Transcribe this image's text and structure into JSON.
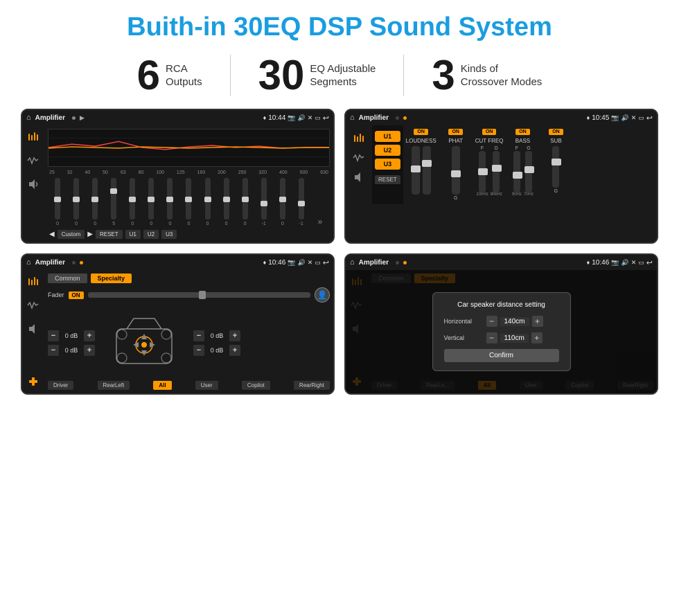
{
  "page": {
    "title": "Buith-in 30EQ DSP Sound System",
    "stats": [
      {
        "number": "6",
        "text_line1": "RCA",
        "text_line2": "Outputs"
      },
      {
        "number": "30",
        "text_line1": "EQ Adjustable",
        "text_line2": "Segments"
      },
      {
        "number": "3",
        "text_line1": "Kinds of",
        "text_line2": "Crossover Modes"
      }
    ]
  },
  "screen1": {
    "status": {
      "title": "Amplifier",
      "time": "10:44"
    },
    "eq_frequencies": [
      "25",
      "32",
      "40",
      "50",
      "63",
      "80",
      "100",
      "125",
      "160",
      "200",
      "250",
      "320",
      "400",
      "500",
      "630"
    ],
    "eq_values": [
      "0",
      "0",
      "0",
      "5",
      "0",
      "0",
      "0",
      "0",
      "0",
      "0",
      "0",
      "-1",
      "0",
      "-1"
    ],
    "buttons": [
      "Custom",
      "RESET",
      "U1",
      "U2",
      "U3"
    ]
  },
  "screen2": {
    "status": {
      "title": "Amplifier",
      "time": "10:45"
    },
    "presets": [
      "U1",
      "U2",
      "U3"
    ],
    "channels": [
      {
        "label": "LOUDNESS",
        "on": true
      },
      {
        "label": "PHAT",
        "on": true
      },
      {
        "label": "CUT FREQ",
        "on": true
      },
      {
        "label": "BASS",
        "on": true
      },
      {
        "label": "SUB",
        "on": true
      }
    ]
  },
  "screen3": {
    "status": {
      "title": "Amplifier",
      "time": "10:46"
    },
    "tabs": [
      "Common",
      "Specialty"
    ],
    "active_tab": "Specialty",
    "fader_label": "Fader",
    "fader_on": "ON",
    "db_controls": [
      {
        "id": "fl",
        "value": "0 dB"
      },
      {
        "id": "rl",
        "value": "0 dB"
      },
      {
        "id": "fr",
        "value": "0 dB"
      },
      {
        "id": "rr",
        "value": "0 dB"
      }
    ],
    "buttons": [
      "Driver",
      "RearLeft",
      "All",
      "User",
      "Copilot",
      "RearRight"
    ]
  },
  "screen4": {
    "status": {
      "title": "Amplifier",
      "time": "10:46"
    },
    "tabs": [
      "Common",
      "Specialty"
    ],
    "active_tab": "Specialty",
    "dialog": {
      "title": "Car speaker distance setting",
      "horizontal_label": "Horizontal",
      "horizontal_value": "140cm",
      "vertical_label": "Vertical",
      "vertical_value": "110cm",
      "confirm_btn": "Confirm"
    },
    "buttons": [
      "Driver",
      "RearLeft",
      "All",
      "User",
      "Copilot",
      "RearRight"
    ]
  },
  "icons": {
    "home": "⌂",
    "location": "♦",
    "speaker": "♪",
    "settings": "⚙",
    "back": "↩",
    "play": "▶",
    "prev": "◀",
    "next": "▶",
    "eq": "≋",
    "wave": "∿"
  }
}
